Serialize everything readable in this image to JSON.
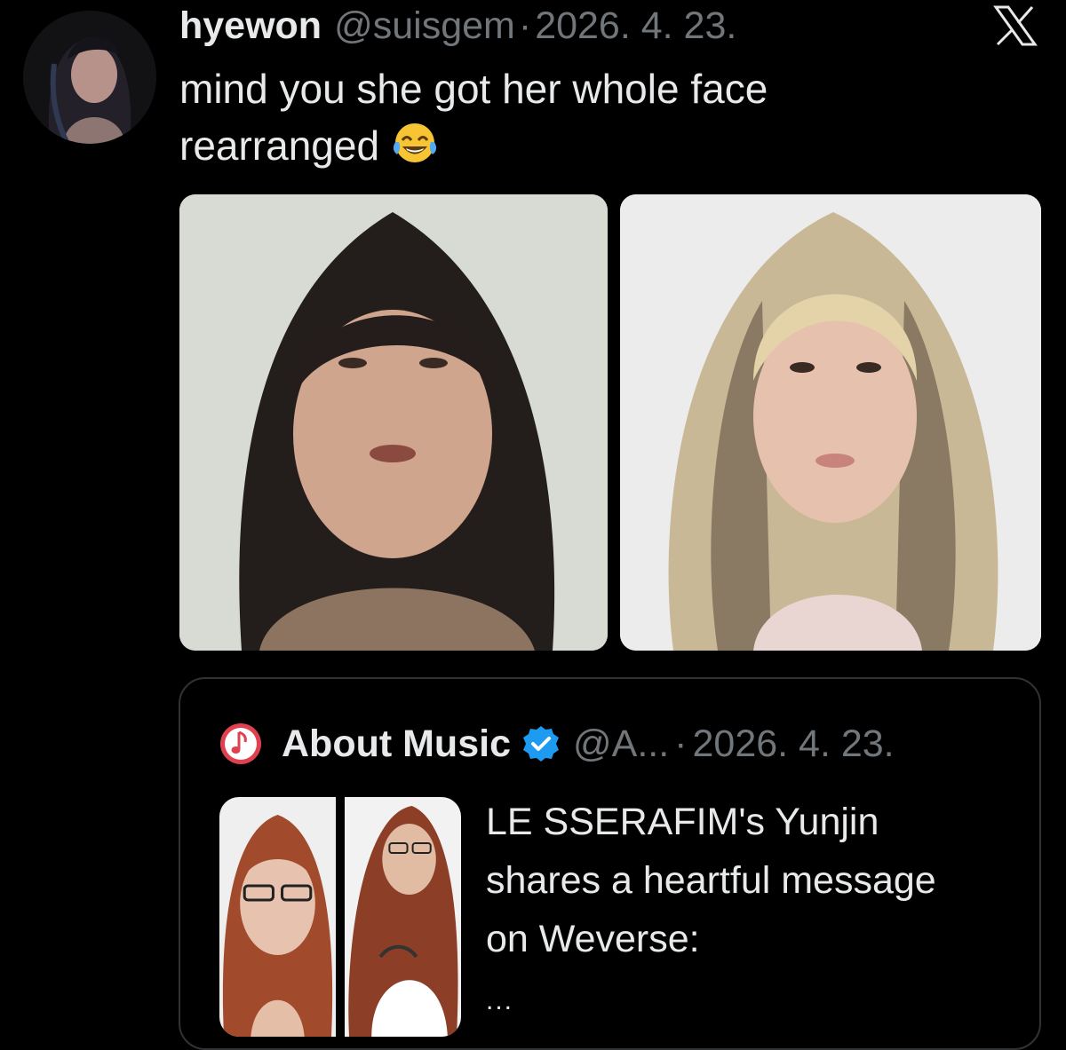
{
  "tweet": {
    "author_name": "hyewon",
    "author_handle": "@suisgem",
    "separator": "·",
    "date": "2026. 4. 23.",
    "text": "mind you she got her whole face rearranged",
    "emoji": "face-with-tears-of-joy"
  },
  "media": [
    {
      "icon": "photo-1"
    },
    {
      "icon": "photo-2"
    }
  ],
  "quote": {
    "author_name": "About Music",
    "author_handle": "@A...",
    "separator": "·",
    "date": "2026. 4. 23.",
    "verified": true,
    "text": "LE SSERAFIM's Yunjin shares a heartful message on Weverse:",
    "ellipsis": "..."
  },
  "colors": {
    "background": "#000000",
    "text": "#e7e9ea",
    "muted": "#71767b",
    "border": "#2f3336",
    "verified": "#1d9bf0",
    "music_logo": "#e0414f"
  }
}
